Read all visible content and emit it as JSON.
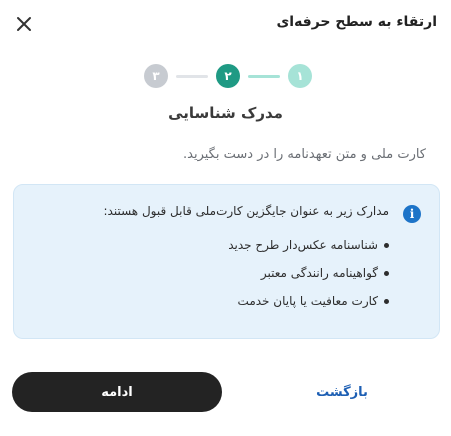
{
  "header": {
    "title": "ارتقاء به سطح حرفه‌ای",
    "close_icon": "close-icon"
  },
  "stepper": {
    "steps": [
      {
        "label": "۱",
        "state": "done"
      },
      {
        "label": "۲",
        "state": "active"
      },
      {
        "label": "۳",
        "state": "todo"
      }
    ],
    "colors": {
      "done": "#a6e3d7",
      "active": "#1f9a84",
      "todo": "#c7cbd1"
    }
  },
  "current_step": {
    "title": "مدرک شناسایی",
    "description": "کارت ملی و متن تعهدنامه را در دست بگیرید."
  },
  "info": {
    "icon": "info-icon",
    "title": "مدارک زیر به عنوان جایگزین کارت‌ملی قابل قبول هستند:",
    "items": [
      "شناسنامه عکس‌دار طرح جدید",
      "گواهینامه رانندگی معتبر",
      "کارت معافیت یا پایان خدمت"
    ]
  },
  "actions": {
    "continue_label": "ادامه",
    "back_label": "بازگشت"
  }
}
